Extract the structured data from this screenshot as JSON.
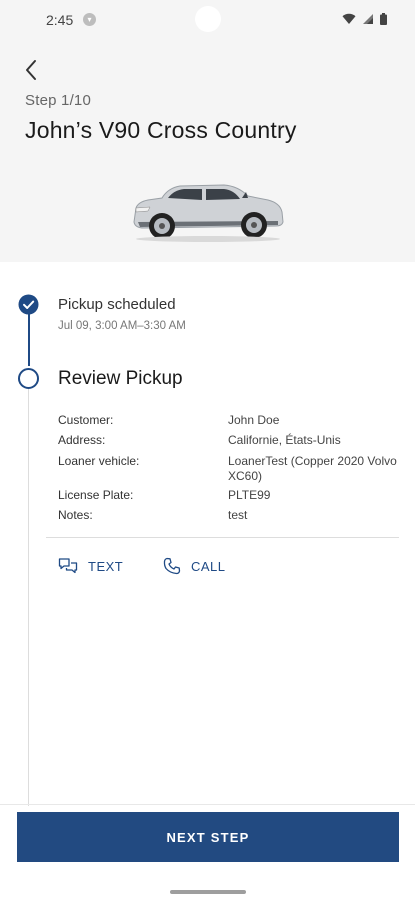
{
  "status_bar": {
    "time": "2:45",
    "notification_icon": "notification-dot-icon",
    "icons": [
      "wifi-icon",
      "signal-icon",
      "battery-icon"
    ]
  },
  "header": {
    "step_label": "Step 1/10",
    "title": "John’s V90 Cross Country",
    "back_icon": "back-arrow-icon",
    "car_image": "car-image"
  },
  "timeline": {
    "completed": {
      "title": "Pickup scheduled",
      "time": "Jul 09, 3:00 AM–3:30 AM"
    },
    "current": {
      "title": "Review Pickup",
      "details": [
        {
          "label": "Customer:",
          "value": "John Doe"
        },
        {
          "label": "Address:",
          "value": "Californie, États-Unis"
        },
        {
          "label": "Loaner vehicle:",
          "value": "LoanerTest (Copper 2020 Volvo XC60)"
        },
        {
          "label": "License Plate:",
          "value": "PLTE99"
        },
        {
          "label": "Notes:",
          "value": "test"
        }
      ]
    }
  },
  "actions": {
    "text_label": "TEXT",
    "call_label": "CALL"
  },
  "footer": {
    "next_label": "NEXT STEP"
  },
  "colors": {
    "primary": "#224a81",
    "header_bg": "#f5f5f5",
    "divider": "#dddddd"
  }
}
